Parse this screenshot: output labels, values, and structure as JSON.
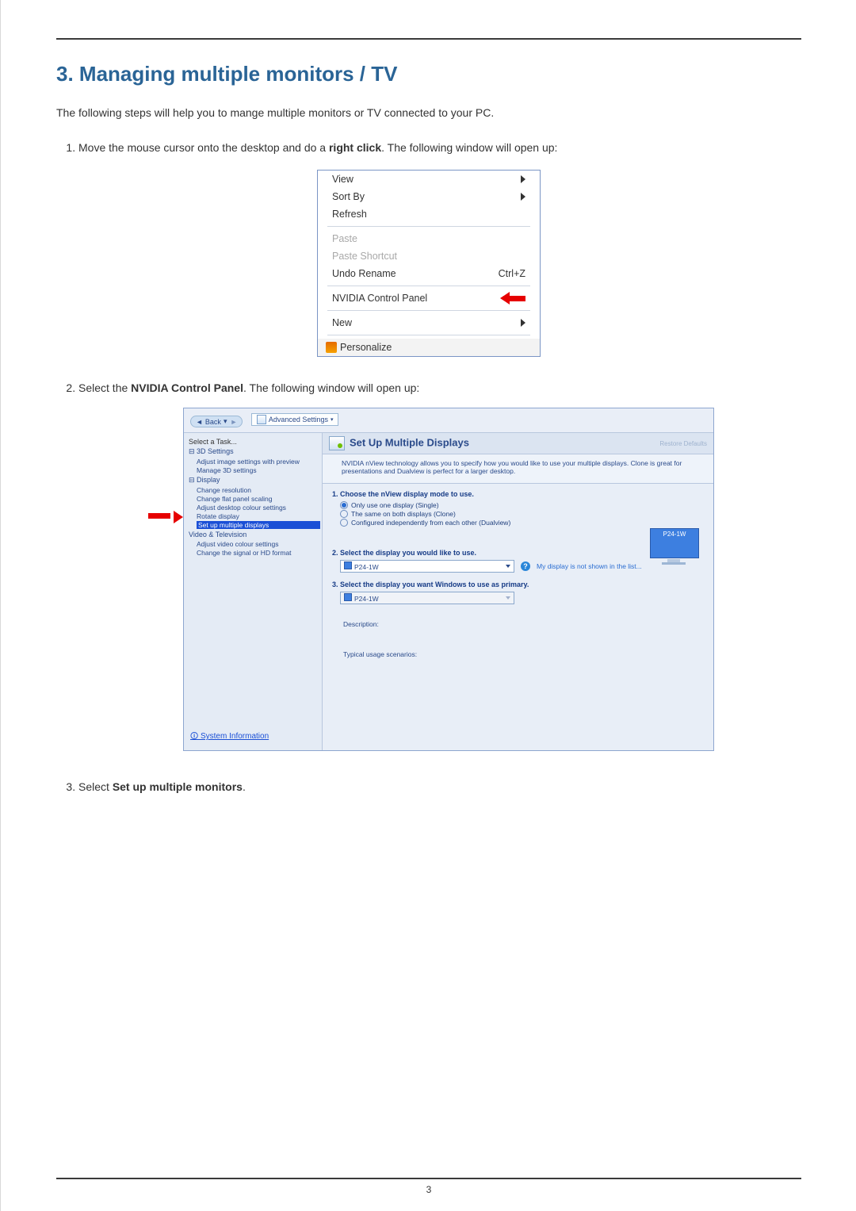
{
  "page_number": "3",
  "heading": "3.  Managing multiple monitors / TV",
  "intro": "The following steps will help you to mange multiple monitors or TV connected to your PC.",
  "steps": {
    "s1_pre": "Move the mouse cursor onto the desktop and do a ",
    "s1_bold": "right click",
    "s1_post": ". The following window will open up:",
    "s2_pre": "Select the ",
    "s2_bold": "NVIDIA Control Panel",
    "s2_post": ". The following window will open up:",
    "s3_pre": "Select ",
    "s3_bold": "Set up multiple monitors",
    "s3_post": "."
  },
  "context_menu": {
    "view": "View",
    "sort_by": "Sort By",
    "refresh": "Refresh",
    "paste": "Paste",
    "paste_shortcut": "Paste Shortcut",
    "undo_rename": "Undo Rename",
    "undo_shortcut": "Ctrl+Z",
    "nvidia": "NVIDIA Control Panel",
    "new": "New",
    "personalize": "Personalize"
  },
  "nvidia_panel": {
    "back": "Back",
    "advanced": "Advanced Settings",
    "select_task": "Select a Task...",
    "tree": {
      "cat_3d": "3D Settings",
      "adj_preview": "Adjust image settings with preview",
      "manage_3d": "Manage 3D settings",
      "cat_display": "Display",
      "change_res": "Change resolution",
      "flat_panel": "Change flat panel scaling",
      "desk_colour": "Adjust desktop colour settings",
      "rotate": "Rotate display",
      "set_up": "Set up multiple displays",
      "cat_video": "Video & Television",
      "vid_colour": "Adjust video colour settings",
      "signal": "Change the signal or HD format"
    },
    "sysinfo": "System Information",
    "main": {
      "title": "Set Up Multiple Displays",
      "restore": "Restore Defaults",
      "desc": "NVIDIA nView technology allows you to specify how you would like to use your multiple displays. Clone is great for presentations and Dualview is perfect for a larger desktop.",
      "h1": "1. Choose the nView display mode to use.",
      "r1": "Only use one display (Single)",
      "r2": "The same on both displays (Clone)",
      "r3": "Configured independently from each other (Dualview)",
      "monitor_label": "P24-1W",
      "h2": "2. Select the display you would like to use.",
      "dd_value": "P24-1W",
      "not_shown": "My display is not shown in the list...",
      "h3": "3. Select the display you want Windows to use as primary.",
      "desc_label": "Description:",
      "usage_label": "Typical usage scenarios:"
    }
  }
}
